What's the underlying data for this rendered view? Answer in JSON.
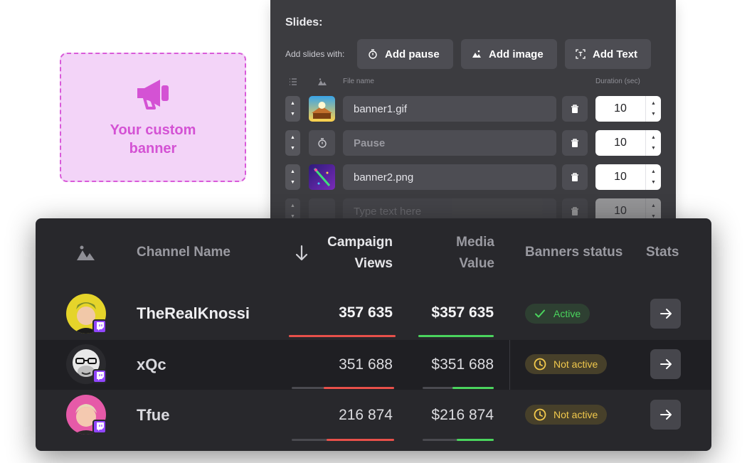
{
  "custom_banner": {
    "line1": "Your custom",
    "line2": "banner",
    "icon": "megaphone-icon",
    "color": "#d452d4"
  },
  "slides": {
    "title": "Slides:",
    "add_label": "Add slides with:",
    "buttons": {
      "add_pause": "Add pause",
      "add_image": "Add image",
      "add_text": "Add Text"
    },
    "columns": {
      "file_name": "File name",
      "duration": "Duration (sec)"
    },
    "rows": [
      {
        "type": "image",
        "value": "banner1.gif",
        "duration": "10"
      },
      {
        "type": "pause",
        "placeholder": "Pause",
        "duration": "10"
      },
      {
        "type": "image",
        "value": "banner2.png",
        "duration": "10"
      },
      {
        "type": "text",
        "placeholder": "Type text here",
        "duration": "10"
      }
    ]
  },
  "table": {
    "headers": {
      "channel_name": "Channel Name",
      "campaign_views_1": "Campaign",
      "campaign_views_2": "Views",
      "media_value_1": "Media",
      "media_value_2": "Value",
      "banners_status": "Banners status",
      "stats": "Stats"
    },
    "rows": [
      {
        "channel": "TheRealKnossi",
        "views": "357 635",
        "media_value": "$357 635",
        "status": "Active",
        "views_bar": 1.0,
        "value_bar": 1.0
      },
      {
        "channel": "xQc",
        "views": "351 688",
        "media_value": "$351 688",
        "status": "Not active",
        "views_bar": 0.69,
        "value_bar": 0.58
      },
      {
        "channel": "Tfue",
        "views": "216 874",
        "media_value": "$216 874",
        "status": "Not active",
        "views_bar": 0.66,
        "value_bar": 0.52
      }
    ],
    "colors": {
      "views_bar": "#e8504a",
      "value_bar": "#4ad45d",
      "active": "#4ad45d",
      "inactive": "#f2c94c",
      "twitch": "#9146ff"
    }
  }
}
